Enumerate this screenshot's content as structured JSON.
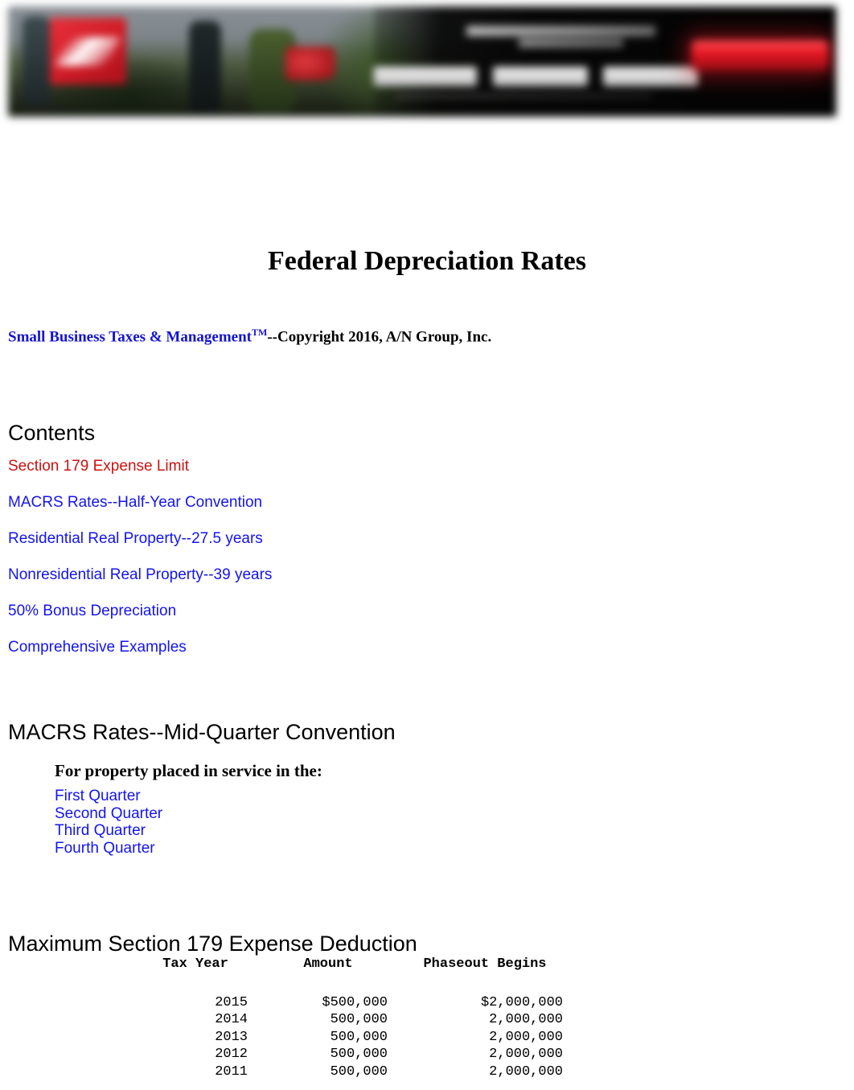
{
  "banner": {
    "name": "advertisement-banner",
    "description": "blurred display advertisement",
    "alt": "Advertisement"
  },
  "page_title": "Federal Depreciation Rates",
  "byline": {
    "link_text": "Small Business Taxes & Management",
    "trademark": "TM",
    "copyright_text": "--Copyright 2016, A/N Group, Inc."
  },
  "contents": {
    "heading": "Contents",
    "links": [
      {
        "label": "Section 179 Expense Limit",
        "state": "visited",
        "color": "#cc1111"
      },
      {
        "label": "MACRS Rates--Half-Year Convention",
        "state": "link",
        "color": "#1414f0"
      },
      {
        "label": "Residential Real Property--27.5 years",
        "state": "link",
        "color": "#1414f0"
      },
      {
        "label": "Nonresidential Real Property--39 years",
        "state": "link",
        "color": "#1414f0"
      },
      {
        "label": "50% Bonus Depreciation",
        "state": "link",
        "color": "#1414f0"
      },
      {
        "label": "Comprehensive Examples",
        "state": "link",
        "color": "#1414f0"
      }
    ]
  },
  "mid_quarter": {
    "heading": "MACRS Rates--Mid-Quarter Convention",
    "lead": "For property placed in service in the:",
    "quarters": [
      {
        "label": "First Quarter"
      },
      {
        "label": "Second Quarter"
      },
      {
        "label": "Third Quarter"
      },
      {
        "label": "Fourth Quarter"
      }
    ]
  },
  "section179": {
    "heading": "Maximum Section 179 Expense Deduction",
    "columns": [
      "Tax Year",
      "Amount",
      "Phaseout Begins"
    ],
    "rows": [
      {
        "tax_year": "2015",
        "amount": "$500,000",
        "phaseout": "$2,000,000"
      },
      {
        "tax_year": "2014",
        "amount": "500,000",
        "phaseout": "2,000,000"
      },
      {
        "tax_year": "2013",
        "amount": "500,000",
        "phaseout": "2,000,000"
      },
      {
        "tax_year": "2012",
        "amount": "500,000",
        "phaseout": "2,000,000"
      },
      {
        "tax_year": "2011",
        "amount": "500,000",
        "phaseout": "2,000,000"
      }
    ]
  },
  "colors": {
    "link": "#1414f0",
    "visited_link": "#cc1111",
    "byline_link": "#1414d2",
    "text": "#000000",
    "background": "#ffffff",
    "ad_accent": "#e01420"
  }
}
